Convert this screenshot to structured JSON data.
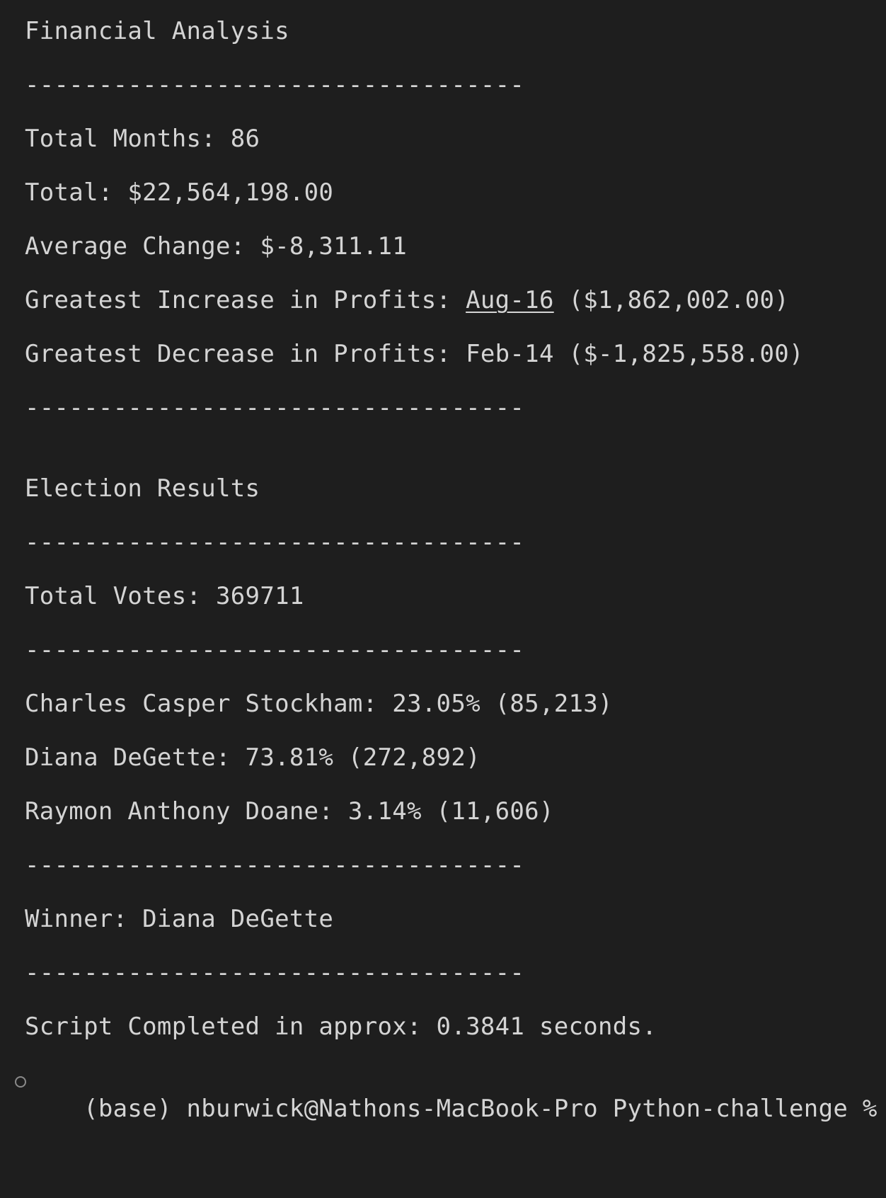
{
  "financial": {
    "title": "Financial Analysis",
    "separator": "----------------------------------",
    "total_months": "Total Months: 86",
    "total": "Total: $22,564,198.00",
    "average_change": "Average Change: $-8,311.11",
    "greatest_increase": {
      "prefix": "Greatest Increase in Profits: ",
      "date": "Aug-16",
      "amount": " ($1,862,002.00)"
    },
    "greatest_decrease": "Greatest Decrease in Profits: Feb-14 ($-1,825,558.00)"
  },
  "election": {
    "title": "Election Results",
    "total_votes": "Total Votes: 369711",
    "candidates": [
      "Charles Casper Stockham: 23.05% (85,213)",
      "Diana DeGette: 73.81% (272,892)",
      "Raymon Anthony Doane: 3.14% (11,606)"
    ],
    "winner": "Winner: Diana DeGette"
  },
  "script_completed": "Script Completed in approx: 0.3841 seconds.",
  "prompt": "(base) nburwick@Nathons-MacBook-Pro Python-challenge % "
}
